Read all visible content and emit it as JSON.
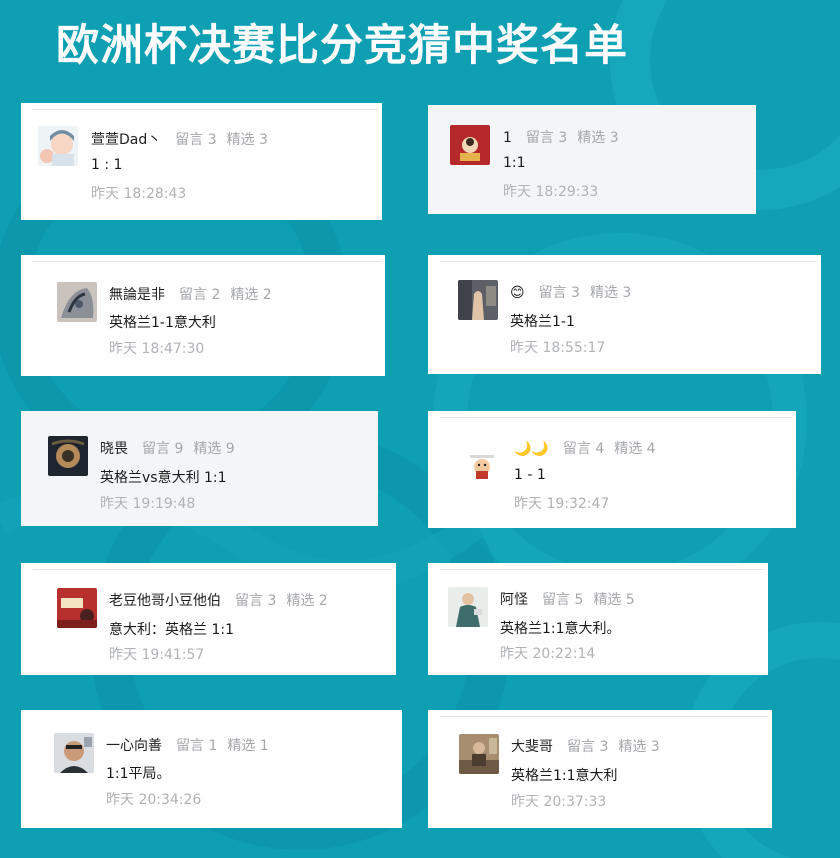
{
  "title": "欧洲杯决赛比分竞猜中奖名单",
  "colors": {
    "background": "#0f9fb3",
    "card": "#ffffff",
    "card_alt": "#f4f5f7",
    "muted_text": "#a5a7ab"
  },
  "entries": [
    {
      "name": "萱萱Dad丶",
      "liuyan": "留言 3",
      "jingxuan": "精选 3",
      "comment": "1 : 1",
      "time": "昨天 18:28:43",
      "avatar": "cartoon-avatar"
    },
    {
      "name": "1",
      "liuyan": "留言 3",
      "jingxuan": "精选 3",
      "comment": "1:1",
      "time": "昨天 18:29:33",
      "avatar": "red-avatar"
    },
    {
      "name": "無論是非",
      "liuyan": "留言 2",
      "jingxuan": "精选 2",
      "comment": "英格兰1-1意大利",
      "time": "昨天 18:47:30",
      "avatar": "tattoo-avatar"
    },
    {
      "name": "😊",
      "liuyan": "留言 3",
      "jingxuan": "精选 3",
      "comment": "英格兰1-1",
      "time": "昨天 18:55:17",
      "avatar": "hand-avatar"
    },
    {
      "name": "晓畏",
      "liuyan": "留言 9",
      "jingxuan": "精选 9",
      "comment": "英格兰vs意大利 1:1",
      "time": "昨天 19:19:48",
      "avatar": "painting-avatar"
    },
    {
      "name": "🌙🌙",
      "liuyan": "留言 4",
      "jingxuan": "精选 4",
      "comment": "1 - 1",
      "time": "昨天 19:32:47",
      "avatar": "sticker-avatar"
    },
    {
      "name": "老豆他哥小豆他伯",
      "liuyan": "留言 3",
      "jingxuan": "精选 2",
      "comment": "意大利：英格兰 1:1",
      "time": "昨天 19:41:57",
      "avatar": "poster-avatar"
    },
    {
      "name": "阿怪",
      "liuyan": "留言 5",
      "jingxuan": "精选 5",
      "comment": "英格兰1:1意大利。",
      "time": "昨天 20:22:14",
      "avatar": "person-avatar"
    },
    {
      "name": "一心向善",
      "liuyan": "留言 1",
      "jingxuan": "精选 1",
      "comment": "1:1平局。",
      "time": "昨天 20:34:26",
      "avatar": "selfie-avatar"
    },
    {
      "name": "大斐哥",
      "liuyan": "留言 3",
      "jingxuan": "精选 3",
      "comment": "英格兰1:1意大利",
      "time": "昨天 20:37:33",
      "avatar": "room-avatar"
    }
  ]
}
